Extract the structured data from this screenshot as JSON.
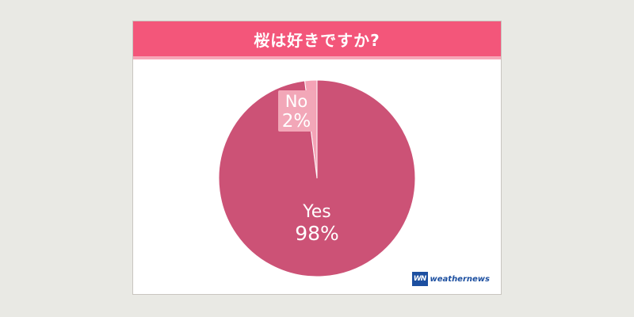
{
  "header": {
    "title": "桜は好きですか?"
  },
  "colors": {
    "header": "#f3567a",
    "yes": "#cc5276",
    "no": "#f4a3b6",
    "no_label_bg": "#f2a7b8"
  },
  "chart_data": {
    "type": "pie",
    "title": "桜は好きですか?",
    "slices": [
      {
        "label": "Yes",
        "value": 98,
        "display": "98%"
      },
      {
        "label": "No",
        "value": 2,
        "display": "2%"
      }
    ]
  },
  "logo": {
    "mark": "WN",
    "text": "weathernews"
  }
}
